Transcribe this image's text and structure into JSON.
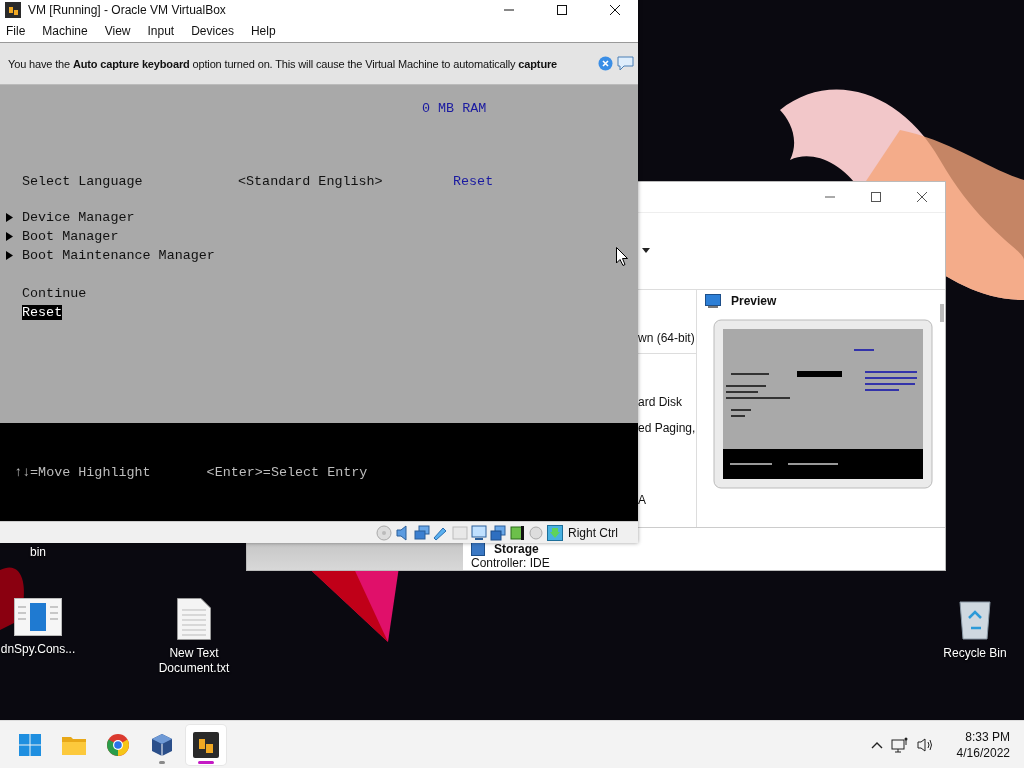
{
  "vm_window": {
    "title": "VM [Running] - Oracle VM VirtualBox",
    "menu": [
      "File",
      "Machine",
      "View",
      "Input",
      "Devices",
      "Help"
    ],
    "notice": "You have the **Auto capture keyboard** option turned on. This will cause the Virtual Machine to automatically **capture**",
    "screen": {
      "ram": "0 MB RAM",
      "language_label": "Select Language",
      "language_value": "<Standard English>",
      "reset_link": "Reset",
      "menu_items": [
        {
          "label": "Device Manager",
          "kind": "submenu",
          "selected": false
        },
        {
          "label": "Boot Manager",
          "kind": "submenu",
          "selected": false
        },
        {
          "label": "Boot Maintenance Manager",
          "kind": "submenu",
          "selected": false
        },
        {
          "label": "Continue",
          "kind": "action",
          "selected": false
        },
        {
          "label": "Reset",
          "kind": "action",
          "selected": true
        }
      ],
      "help_keys": [
        "↑↓=Move Highlight",
        "<Enter>=Select Entry"
      ]
    },
    "status_bar": {
      "host_key": "Right Ctrl"
    }
  },
  "manager_window": {
    "preview_title": "Preview",
    "details": [
      "wn (64-bit)",
      "ard Disk",
      "ed Paging,",
      "A"
    ],
    "storage_title": "Storage",
    "storage_line": "Controller: IDE"
  },
  "desktop_icons": [
    {
      "label": "bin"
    },
    {
      "label": "dnSpy.Cons...",
      "kind": "app"
    },
    {
      "label": "New Text Document.txt",
      "kind": "text_file"
    },
    {
      "label": "Recycle Bin",
      "kind": "recycle_bin"
    }
  ],
  "taskbar": {
    "apps": [
      {
        "kind": "start",
        "running": false,
        "selected": false
      },
      {
        "kind": "explorer",
        "running": false,
        "selected": false
      },
      {
        "kind": "chrome",
        "running": false,
        "selected": false
      },
      {
        "kind": "virtualbox",
        "running": true,
        "selected": false
      },
      {
        "kind": "vm",
        "running": true,
        "selected": true
      }
    ],
    "time": "8:33 PM",
    "date": "4/16/2022"
  }
}
